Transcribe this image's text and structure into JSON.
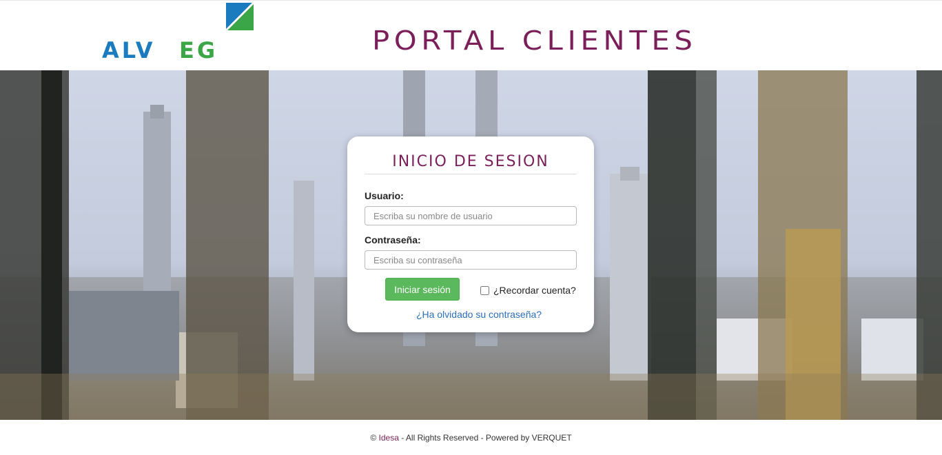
{
  "header": {
    "logo_text": "ALVEG",
    "title": "PORTAL CLIENTES"
  },
  "login": {
    "title": "INICIO DE SESION",
    "username_label": "Usuario:",
    "username_placeholder": "Escriba su nombre de usuario",
    "username_value": "",
    "password_label": "Contraseña:",
    "password_placeholder": "Escriba su contraseña",
    "password_value": "",
    "submit_label": "Iniciar sesión",
    "remember_label": "¿Recordar cuenta?",
    "remember_checked": false,
    "forgot_label": "¿Ha olvidado su contraseña?"
  },
  "footer": {
    "copyright": "©",
    "brand": "Idesa",
    "rest": " - All Rights Reserved - Powered by VERQUET"
  },
  "colors": {
    "brand_purple": "#7a1f5a",
    "logo_blue": "#1a7bbf",
    "logo_green": "#3aa648",
    "button_green": "#5cb85c",
    "link_blue": "#2a6ebb"
  }
}
